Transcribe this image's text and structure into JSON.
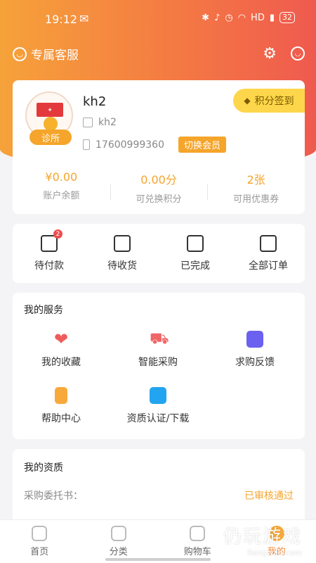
{
  "status": {
    "time": "19:12",
    "network": "HD",
    "battery": "32"
  },
  "topbar": {
    "customer_service": "专属客服"
  },
  "profile": {
    "name": "kh2",
    "company": "kh2",
    "phone": "17600999360",
    "avatar_tag": "诊所",
    "switch_label": "切换会员",
    "sign_label": "积分签到"
  },
  "stats": [
    {
      "value": "¥0.00",
      "label": "账户余额"
    },
    {
      "value": "0.00分",
      "label": "可兑换积分"
    },
    {
      "value": "2张",
      "label": "可用优惠券"
    }
  ],
  "orders": [
    {
      "label": "待付款",
      "badge": "2"
    },
    {
      "label": "待收货"
    },
    {
      "label": "已完成"
    },
    {
      "label": "全部订单"
    }
  ],
  "services": {
    "title": "我的服务",
    "items": [
      {
        "label": "我的收藏",
        "icon": "heart-icon"
      },
      {
        "label": "智能采购",
        "icon": "cart-icon"
      },
      {
        "label": "求购反馈",
        "icon": "feedback-icon"
      },
      {
        "label": "帮助中心",
        "icon": "bulb-icon"
      },
      {
        "label": "资质认证/下载",
        "icon": "camera-icon"
      }
    ]
  },
  "qualification": {
    "title": "我的资质",
    "rows": [
      {
        "label": "采购委托书：",
        "status": "已审核通过"
      }
    ]
  },
  "tabs": [
    {
      "label": "首页"
    },
    {
      "label": "分类"
    },
    {
      "label": "购物车"
    },
    {
      "label": "我的"
    }
  ],
  "watermark": {
    "title": "仍玩游戏",
    "sub": "Rengwan.com"
  },
  "colors": {
    "accent": "#f5a52b",
    "hero_start": "#f6a23a",
    "hero_end": "#ef5a4f"
  }
}
